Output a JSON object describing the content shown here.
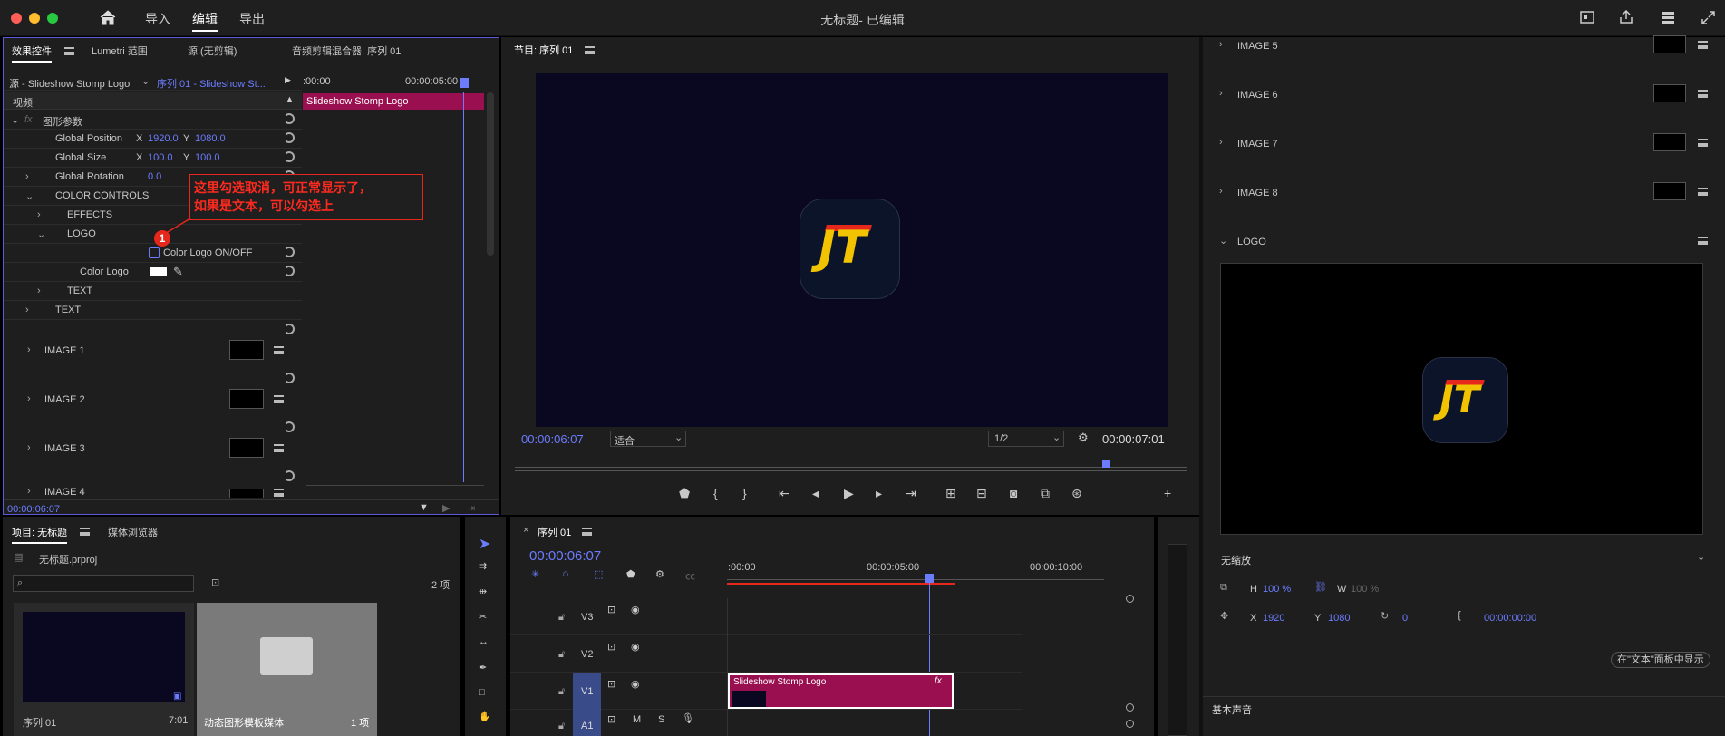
{
  "app": {
    "title": "无标题- 已编辑",
    "menus": [
      "导入",
      "编辑",
      "导出"
    ]
  },
  "effect_controls": {
    "tabs": [
      "效果控件",
      "Lumetri 范围",
      "源:(无剪辑)",
      "音频剪辑混合器: 序列 01"
    ],
    "source": "源 - Slideshow Stomp Logo",
    "sequence": "序列 01 - Slideshow St...",
    "ruler_start": ":00:00",
    "ruler_end": "00:00:05:00",
    "clip_name": "Slideshow Stomp Logo",
    "video_label": "视频",
    "graphic_params": "图形参数",
    "global_position": {
      "label": "Global Position",
      "x": "1920.0",
      "y": "1080.0"
    },
    "global_size": {
      "label": "Global Size",
      "x": "100.0",
      "y": "100.0"
    },
    "global_rotation": {
      "label": "Global Rotation",
      "value": "0.0"
    },
    "color_controls": "COLOR CONTROLS",
    "effects": "EFFECTS",
    "logo": "LOGO",
    "color_logo_onoff": "Color Logo ON/OFF",
    "color_logo": "Color Logo",
    "text_sub": "TEXT",
    "text": "TEXT",
    "images": [
      "IMAGE 1",
      "IMAGE 2",
      "IMAGE 3",
      "IMAGE 4"
    ],
    "timecode": "00:00:06:07",
    "x_label": "X",
    "y_label": "Y"
  },
  "annotation": {
    "number": "1",
    "line1": "这里勾选取消，可正常显示了，",
    "line2": "如果是文本，可以勾选上"
  },
  "program": {
    "title": "节目: 序列 01",
    "timecode": "00:00:06:07",
    "fit": "适合",
    "resolution": "1/2",
    "duration": "00:00:07:01"
  },
  "project": {
    "tabs": [
      "项目: 无标题",
      "媒体浏览器"
    ],
    "file": "无标题.prproj",
    "count": "2 项",
    "items": [
      {
        "name": "序列 01",
        "meta": "7:01"
      },
      {
        "name": "动态图形模板媒体",
        "meta": "1 项"
      }
    ]
  },
  "timeline": {
    "title": "序列 01",
    "timecode": "00:00:06:07",
    "ruler": [
      ":00:00",
      "00:00:05:00",
      "00:00:10:00"
    ],
    "tracks": [
      "V3",
      "V2",
      "V1",
      "A1"
    ],
    "clip_name": "Slideshow Stomp Logo",
    "fx": "fx",
    "m": "M",
    "s": "S"
  },
  "essential": {
    "images": [
      "IMAGE 5",
      "IMAGE 6",
      "IMAGE 7",
      "IMAGE 8"
    ],
    "logo": "LOGO",
    "scale": "无缩放",
    "h": "100 %",
    "w": "100 %",
    "x": "1920",
    "y": "1080",
    "rotation": "0",
    "time": "00:00:00:00",
    "h_label": "H",
    "w_label": "W",
    "x_label": "X",
    "y_label": "Y",
    "edit_text": "在\"文本\"面板中显示",
    "audio": "基本声音"
  },
  "colors": {
    "accent": "#6b7cff",
    "clip": "#9a0f4f",
    "annotation": "#e5271c"
  }
}
